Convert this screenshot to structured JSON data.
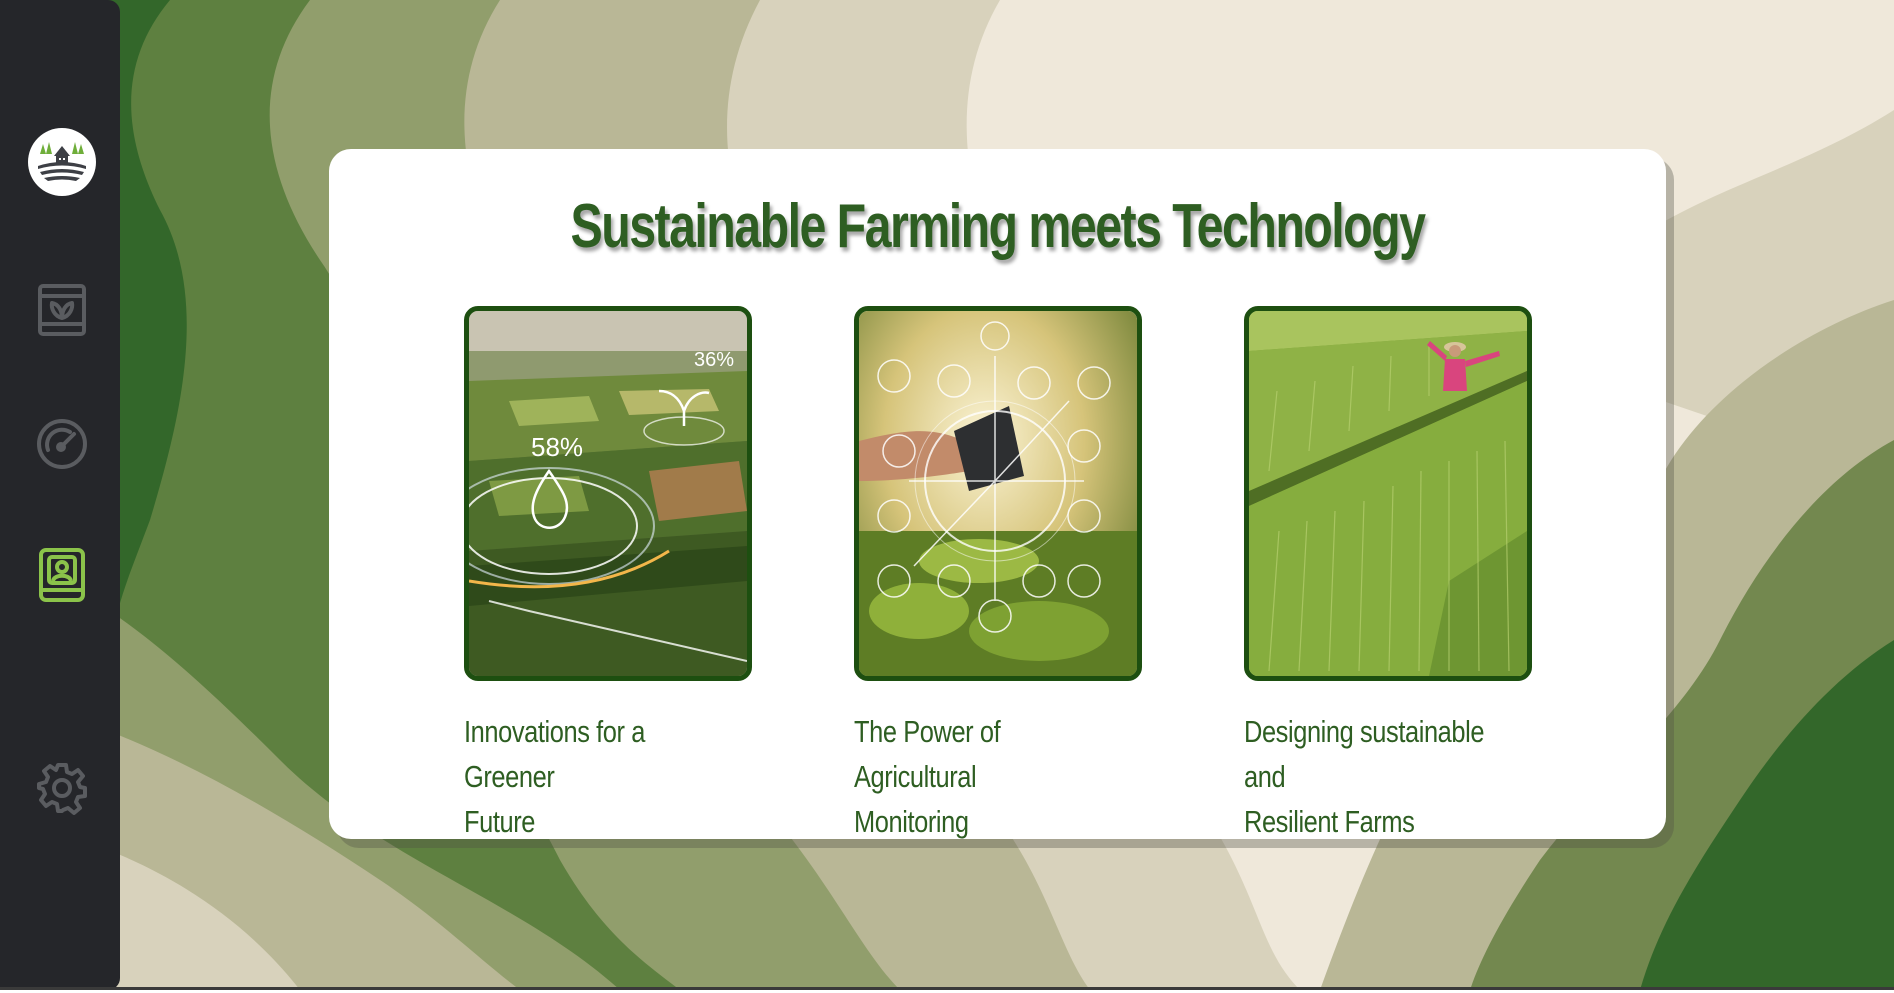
{
  "page": {
    "title": "Sustainable Farming meets Technology"
  },
  "sidebar": {
    "items": [
      {
        "icon": "seed-bag-icon"
      },
      {
        "icon": "gauge-icon"
      },
      {
        "icon": "contact-book-icon",
        "active": true
      },
      {
        "icon": "gear-icon"
      }
    ]
  },
  "features": [
    {
      "caption_line1": "Innovations for a Greener",
      "caption_line2": "Future",
      "overlay_pct_1": "58%",
      "overlay_pct_2": "36%"
    },
    {
      "caption_line1": "The Power of Agricultural",
      "caption_line2": "Monitoring"
    },
    {
      "caption_line1": "Designing sustainable and",
      "caption_line2": "Resilient Farms"
    }
  ],
  "colors": {
    "brand_green": "#2e5e22",
    "frame_green": "#1d4f10",
    "sidebar_bg": "#25262a",
    "active_icon": "#8bc34a",
    "inactive_icon": "#5a5c60"
  }
}
